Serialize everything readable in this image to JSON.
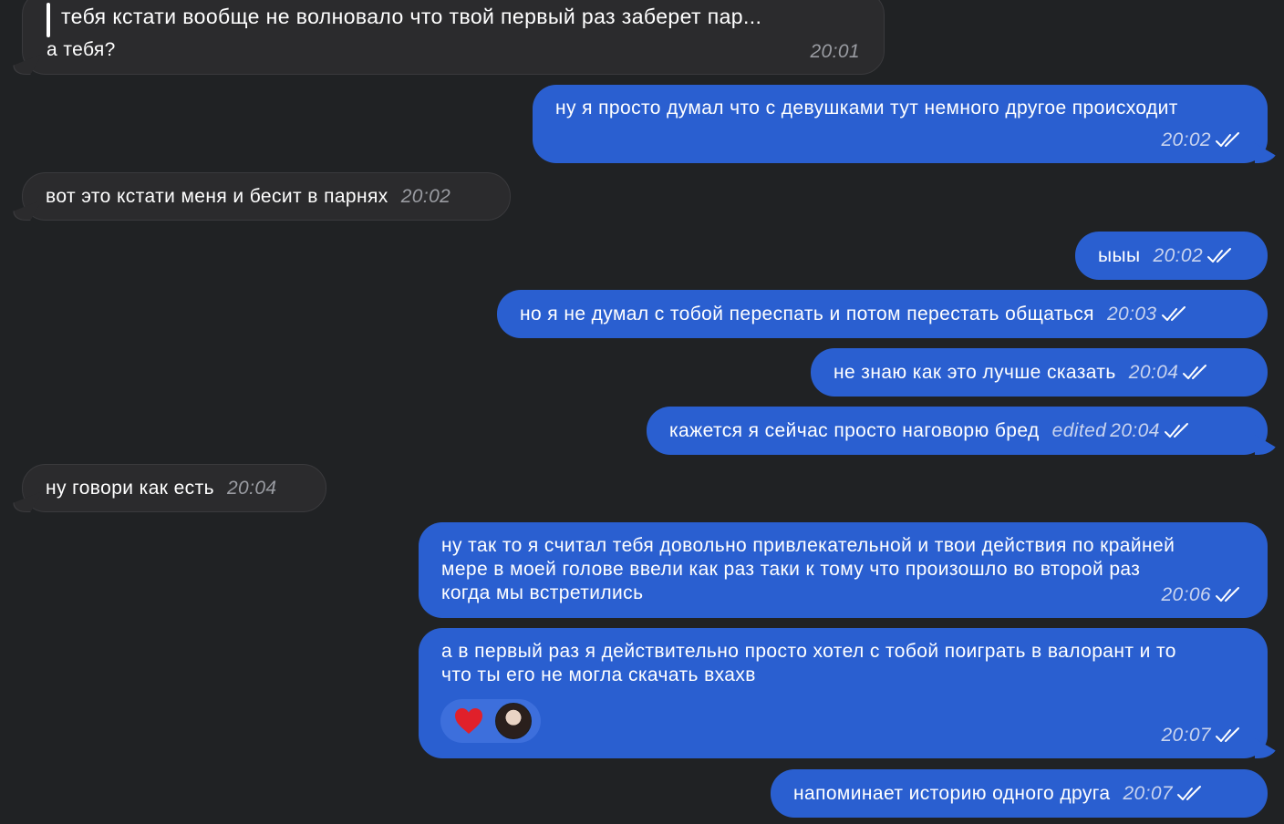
{
  "messages": [
    {
      "id": "m1",
      "direction": "in",
      "reply_preview": "тебя кстати вообще не волновало что твой первый раз заберет пар...",
      "text": "а тебя?",
      "time": "20:01"
    },
    {
      "id": "m2",
      "direction": "out",
      "text": "ну я просто думал что с девушками тут немного другое происходит",
      "time": "20:02",
      "status": "read"
    },
    {
      "id": "m3",
      "direction": "in",
      "text": "вот это кстати меня и бесит в парнях",
      "time": "20:02"
    },
    {
      "id": "m4",
      "direction": "out",
      "text": "ыыы",
      "time": "20:02",
      "status": "read"
    },
    {
      "id": "m5",
      "direction": "out",
      "text": "но я не думал с тобой переспать и потом перестать общаться",
      "time": "20:03",
      "status": "read"
    },
    {
      "id": "m6",
      "direction": "out",
      "text": "не знаю как это лучше сказать",
      "time": "20:04",
      "status": "read"
    },
    {
      "id": "m7",
      "direction": "out",
      "text": "кажется я сейчас просто наговорю бред",
      "edited_label": "edited",
      "time": "20:04",
      "status": "read"
    },
    {
      "id": "m8",
      "direction": "in",
      "text": "ну говори как есть",
      "time": "20:04"
    },
    {
      "id": "m9",
      "direction": "out",
      "lines": [
        "ну так то я считал тебя довольно привлекательной и твои действия по крайней",
        "мере в моей голове ввели как раз таки к тому что произошло во второй раз",
        "когда мы встретились"
      ],
      "time": "20:06",
      "status": "read"
    },
    {
      "id": "m10",
      "direction": "out",
      "lines": [
        "а в первый раз я действительно просто хотел с тобой поиграть в валорант и то",
        "что ты его не могла скачать вхахв"
      ],
      "reaction": {
        "icon": "heart-icon",
        "color": "#e0202a"
      },
      "time": "20:07",
      "status": "read"
    },
    {
      "id": "m11",
      "direction": "out",
      "text": "напоминает историю одного друга",
      "time": "20:07",
      "status": "read"
    }
  ],
  "colors": {
    "background": "#202224",
    "incoming_bubble": "#2b2b2d",
    "outgoing_bubble": "#2a5fd0",
    "timestamp_outgoing": "#c9d4ef",
    "timestamp_incoming": "#9a9ca2"
  }
}
